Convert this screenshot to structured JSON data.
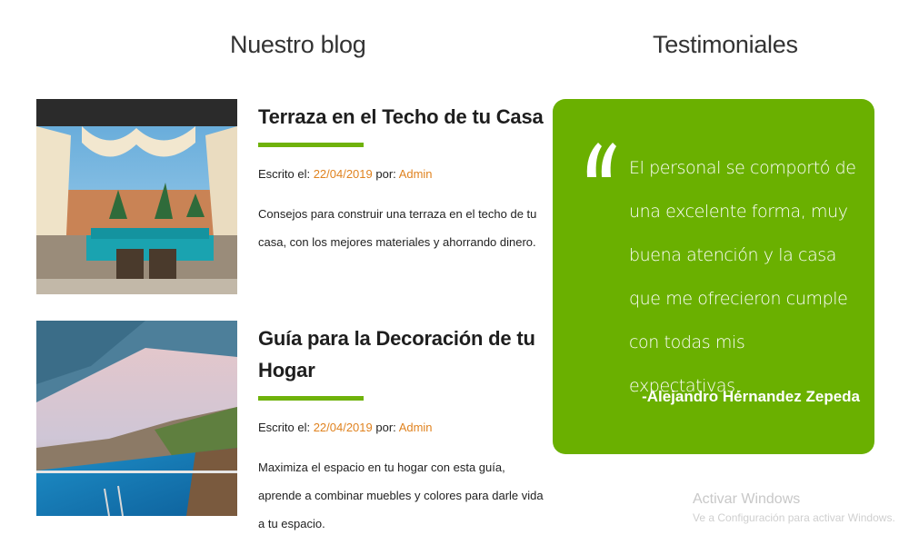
{
  "blog": {
    "heading": "Nuestro blog",
    "posts": [
      {
        "title": "Terraza en el Techo de tu Casa",
        "meta_prefix": "Escrito el: ",
        "date": "22/04/2019",
        "meta_by": " por: ",
        "author": "Admin",
        "excerpt": "Consejos para construir una terraza en el techo de tu casa, con los mejores materiales y ahorrando dinero.",
        "image": "rooftop-terrace-photo"
      },
      {
        "title": "Guía para la Decoración de tu Hogar",
        "meta_prefix": "Escrito el: ",
        "date": "22/04/2019",
        "meta_by": " por: ",
        "author": "Admin",
        "excerpt": "Maximiza el espacio en tu hogar con esta guía, aprende a combinar muebles y colores para darle vida a tu espacio.",
        "image": "infinity-pool-photo"
      }
    ]
  },
  "testimonials": {
    "heading": "Testimoniales",
    "quote": "El personal se comportó de una excelente forma, muy buena atención y la casa que me ofrecieron cumple con todas mis expectativas.",
    "author": "-Alejandro Hérnandez Zepeda",
    "quote_icon": "quote-icon"
  },
  "watermark": {
    "title": "Activar Windows",
    "subtitle": "Ve a Configuración para activar Windows."
  },
  "colors": {
    "accent_green": "#6fb20a",
    "card_green": "#6ab000",
    "link_orange": "#e08320"
  }
}
